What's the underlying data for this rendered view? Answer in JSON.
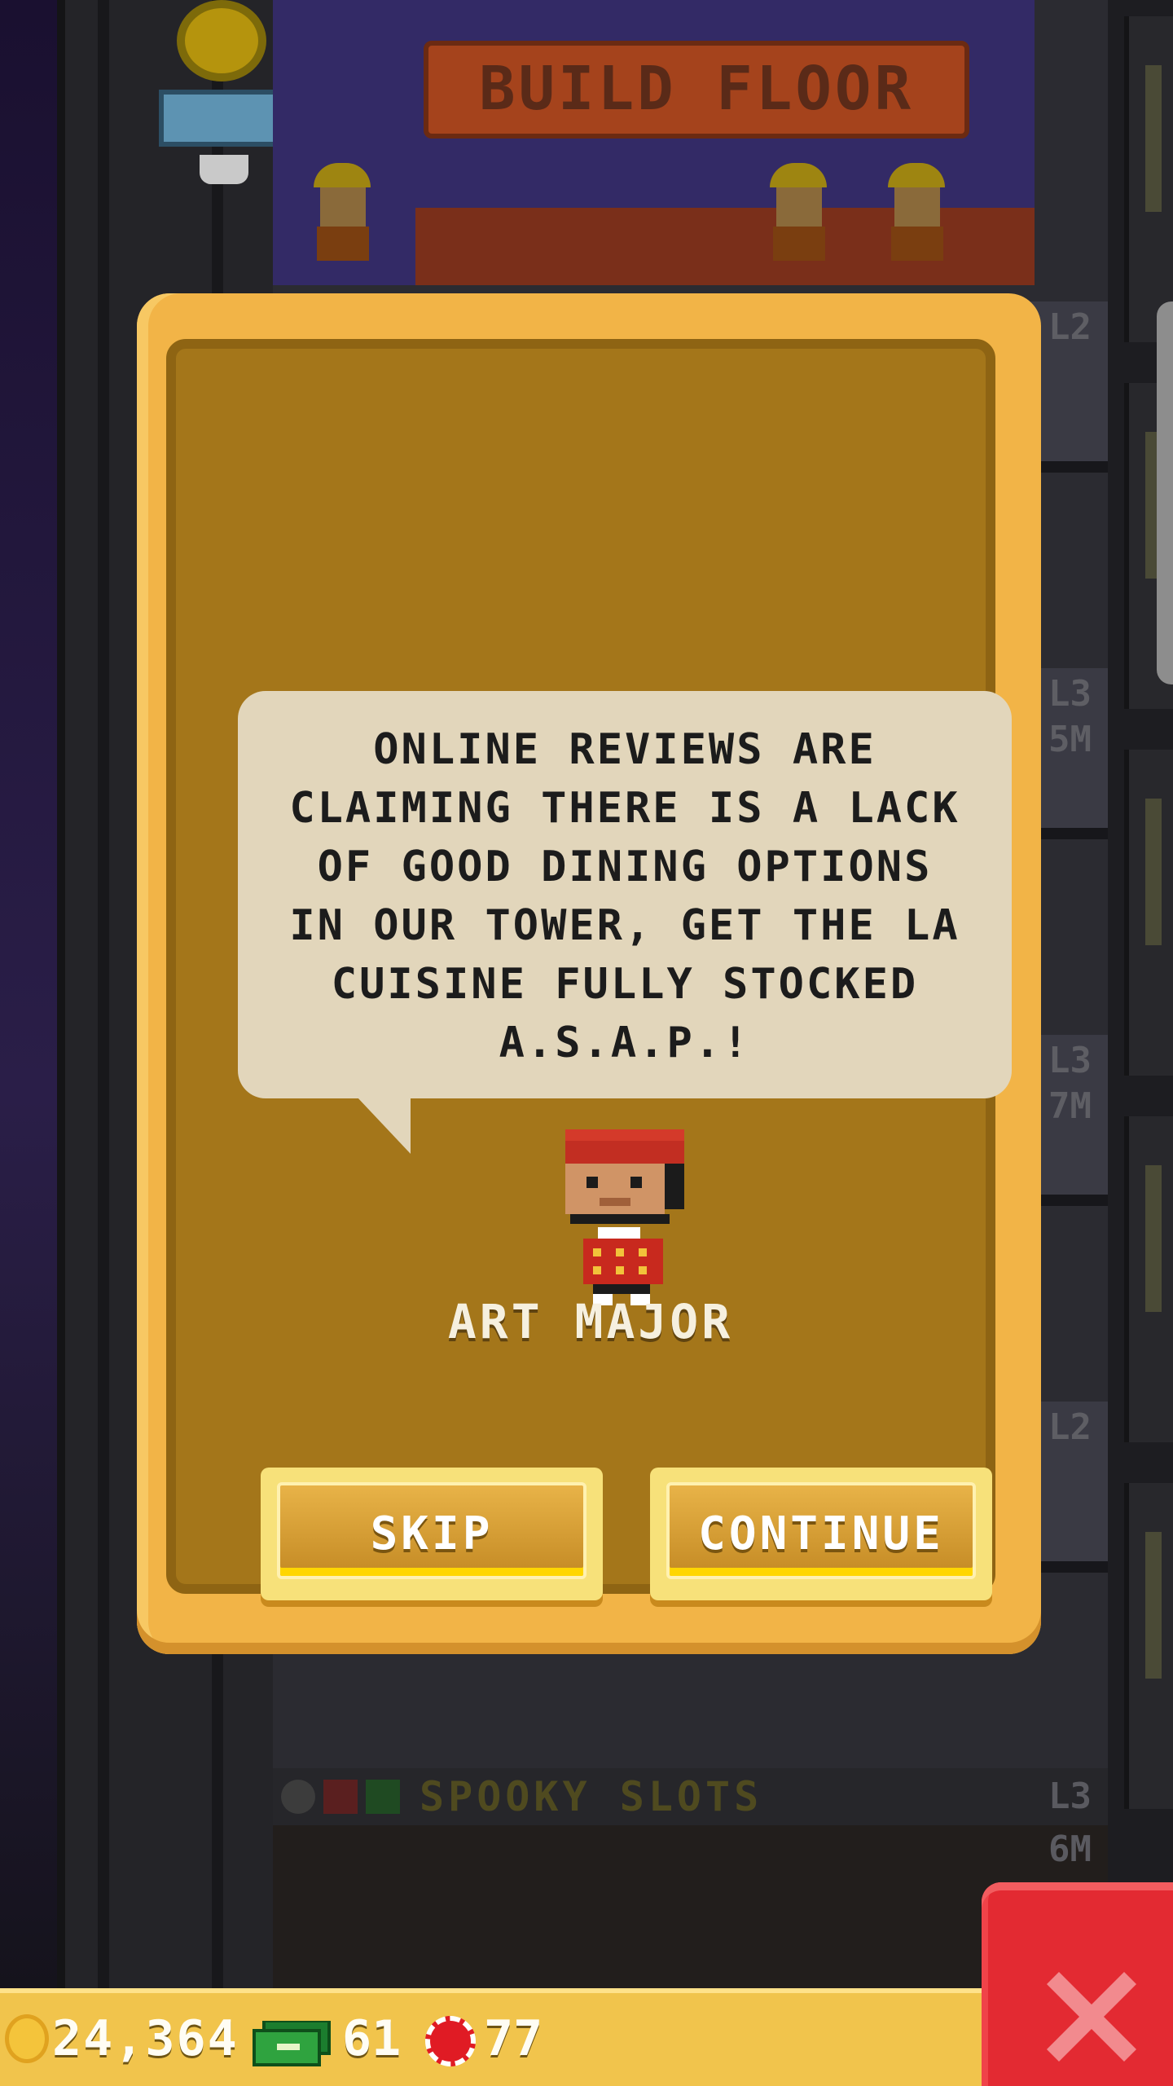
{
  "background": {
    "build_floor_sign": "BUILD FLOOR",
    "floor_levels": [
      "L2",
      "L3",
      "L3",
      "L2"
    ],
    "floor_prices": [
      "5M",
      "7M"
    ],
    "spooky_floor": {
      "name": "SPOOKY SLOTS",
      "level": "L3",
      "price": "6M"
    }
  },
  "dialog": {
    "message": "ONLINE REVIEWS ARE CLAIMING THERE IS A LACK OF GOOD DINING OPTIONS IN OUR TOWER, GET THE LA CUISINE FULLY STOCKED A.S.A.P.!",
    "character_name": "ART MAJOR",
    "skip_label": "SKIP",
    "continue_label": "CONTINUE"
  },
  "resources": {
    "coins": "24,364",
    "cash": "61",
    "chips": "77"
  },
  "colors": {
    "dialog_frame": "#f2b447",
    "dialog_body": "#a4761a",
    "speech_bubble": "#e2d6bb",
    "close_button": "#e32a32",
    "bottom_bar": "#f1c44c"
  },
  "icons": {
    "coin": "coin-icon",
    "cash": "cash-icon",
    "chip": "chip-icon",
    "close": "close-icon"
  }
}
